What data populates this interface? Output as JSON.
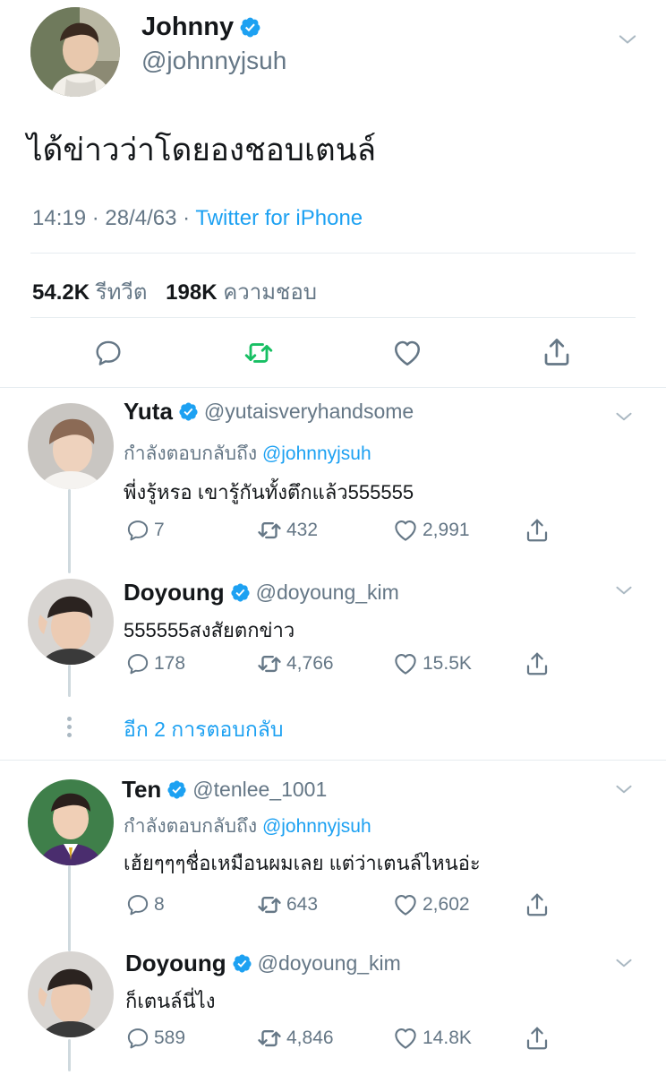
{
  "main_tweet": {
    "name": "Johnny",
    "handle": "@johnnyjsuh",
    "text": "ได้ข่าวว่าโดยองชอบเตนล์",
    "time": "14:19",
    "sep1": "·",
    "date": "28/4/63",
    "sep2": "·",
    "source": "Twitter for iPhone",
    "retweets_count": "54.2K",
    "retweets_label": "รีทวีต",
    "likes_count": "198K",
    "likes_label": "ความชอบ"
  },
  "replies": [
    {
      "name": "Yuta",
      "handle": "@yutaisveryhandsome",
      "replying_prefix": "กำลังตอบกลับถึง",
      "replying_to": "@johnnyjsuh",
      "text": "พี่งรู้หรอ เขารู้กันทั้งตึกแล้ว555555",
      "replies": "7",
      "retweets": "432",
      "likes": "2,991"
    },
    {
      "name": "Doyoung",
      "handle": "@doyoung_kim",
      "text": "555555สงสัยตกข่าว",
      "replies": "178",
      "retweets": "4,766",
      "likes": "15.5K"
    },
    {
      "name": "Ten",
      "handle": "@tenlee_1001",
      "replying_prefix": "กำลังตอบกลับถึง",
      "replying_to": "@johnnyjsuh",
      "text": "เฮ้ยๆๆๆชื่อเหมือนผมเลย แต่ว่าเตนล์ไหนอ่ะ",
      "replies": "8",
      "retweets": "643",
      "likes": "2,602"
    },
    {
      "name": "Doyoung",
      "handle": "@doyoung_kim",
      "text": "ก็เตนล์นี่ไง",
      "replies": "589",
      "retweets": "4,846",
      "likes": "14.8K"
    }
  ],
  "more_replies": "อีก 2 การตอบกลับ",
  "colors": {
    "accent": "#1da1f2",
    "retweet_green": "#17bf63",
    "secondary_text": "#657786",
    "divider": "#e6ecf0"
  },
  "icons": [
    "verified-badge-icon",
    "chevron-down-icon",
    "reply-icon",
    "retweet-icon",
    "like-icon",
    "share-icon"
  ]
}
